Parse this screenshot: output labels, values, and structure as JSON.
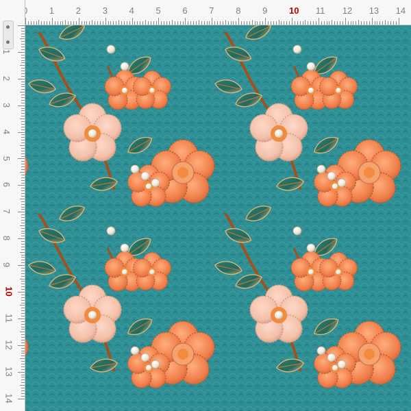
{
  "ruler": {
    "unit_labels": [
      "0",
      "1",
      "2",
      "3",
      "4",
      "5",
      "6",
      "7",
      "8",
      "9",
      "10",
      "11",
      "12",
      "13",
      "14"
    ],
    "highlight_label": "10",
    "highlight_color": "#b30000"
  },
  "fabric": {
    "background_color": "#2f8f94",
    "pattern": "3D felt flowers with pearls and teal leaves on textured teal leather",
    "colors": {
      "flower_orange": "#f07f4a",
      "flower_peach": "#f3c1aa",
      "leaf_teal": "#2b7a6a",
      "leaf_gold": "#c8a36b",
      "stem_brown": "#a0521e",
      "pearl": "#efe6d7"
    }
  }
}
